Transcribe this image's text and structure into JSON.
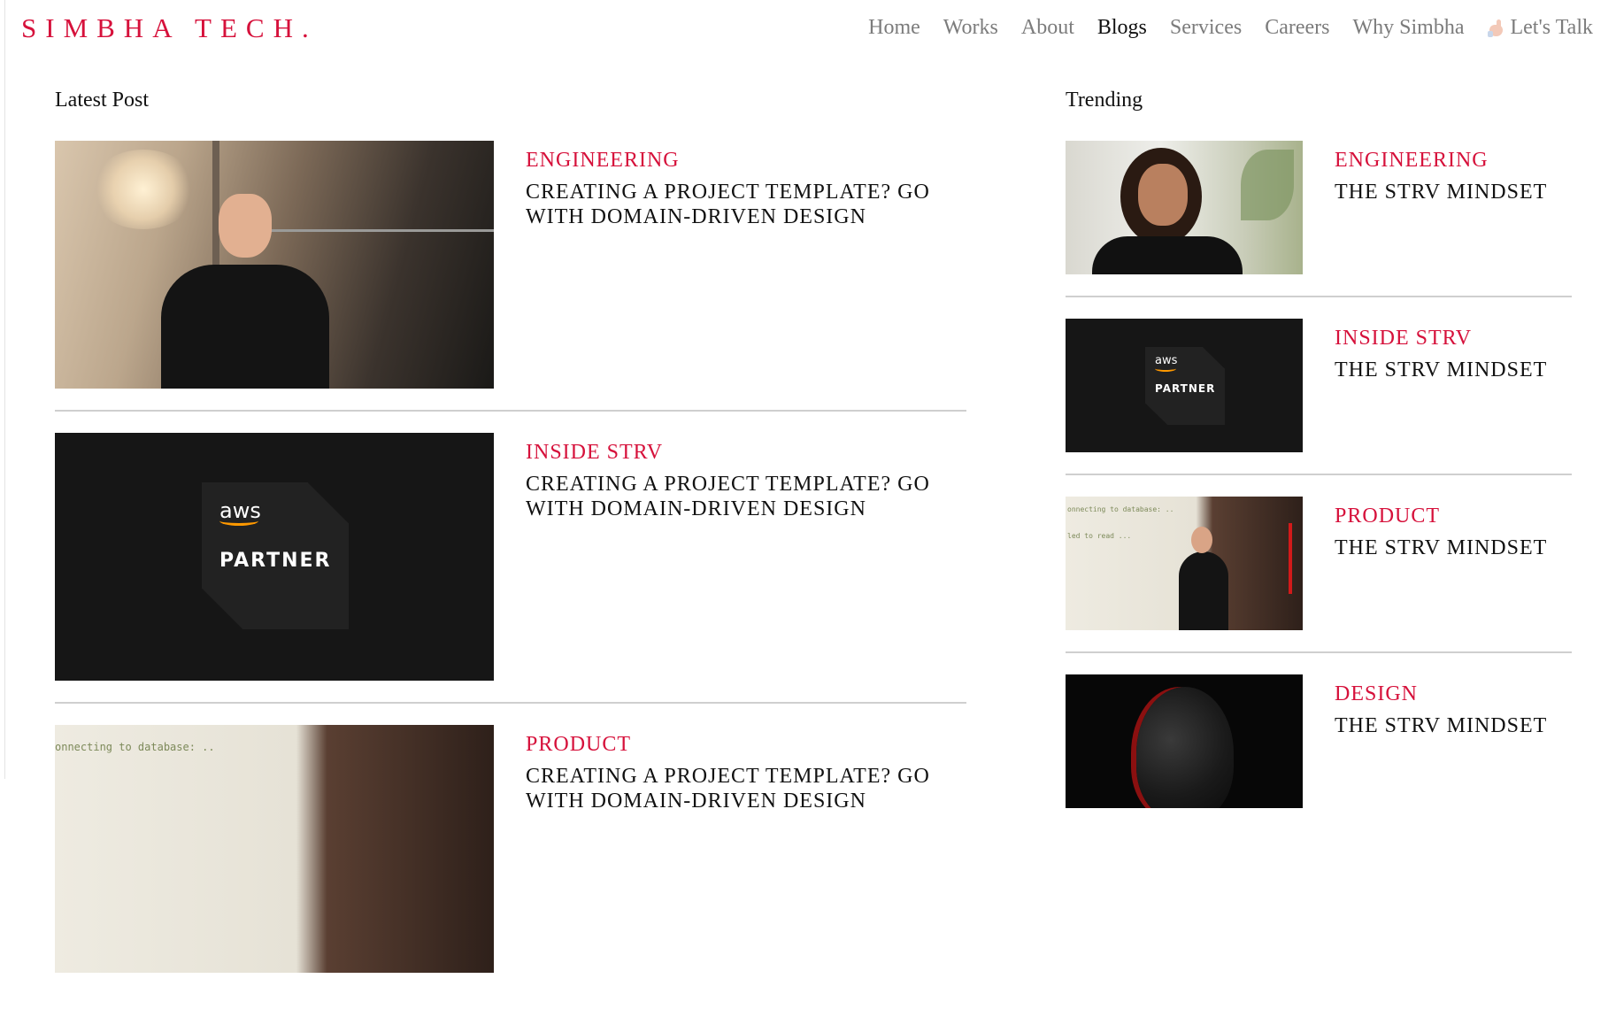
{
  "header": {
    "brand": "SIMBHA TECH.",
    "nav": [
      {
        "label": "Home",
        "active": false
      },
      {
        "label": "Works",
        "active": false
      },
      {
        "label": "About",
        "active": false
      },
      {
        "label": "Blogs",
        "active": true
      },
      {
        "label": "Services",
        "active": false
      },
      {
        "label": "Careers",
        "active": false
      },
      {
        "label": "Why Simbha",
        "active": false
      }
    ],
    "cta": {
      "label": "Let's Talk",
      "icon": "waving-hand-icon"
    }
  },
  "colors": {
    "accent": "#d6113b",
    "text": "#111111",
    "nav_inactive": "#7c7c7c",
    "divider": "#cfcfcf"
  },
  "latest": {
    "title": "Latest Post",
    "posts": [
      {
        "category": "ENGINEERING",
        "title": "CREATING A PROJECT TEMPLATE? GO WITH DOMAIN-DRIVEN DESIGN",
        "image": "man-on-terrace-photo"
      },
      {
        "category": "INSIDE STRV",
        "title": "CREATING A PROJECT TEMPLATE? GO WITH DOMAIN-DRIVEN DESIGN",
        "image": "aws-partner-badge"
      },
      {
        "category": "PRODUCT",
        "title": "CREATING A PROJECT TEMPLATE? GO WITH DOMAIN-DRIVEN DESIGN",
        "image": "speaker-presentation-photo"
      }
    ]
  },
  "trending": {
    "title": "Trending",
    "posts": [
      {
        "category": "ENGINEERING",
        "title": "THE STRV MINDSET",
        "image": "woman-portrait-photo"
      },
      {
        "category": "INSIDE STRV",
        "title": "THE STRV MINDSET",
        "image": "aws-partner-badge"
      },
      {
        "category": "PRODUCT",
        "title": "THE STRV MINDSET",
        "image": "speaker-presentation-photo"
      },
      {
        "category": "DESIGN",
        "title": "THE STRV MINDSET",
        "image": "dark-head-sculpture-photo"
      }
    ]
  },
  "aws_badge": {
    "logo": "aws",
    "label": "PARTNER"
  },
  "talk_code": {
    "line1": "onnecting to database: ..",
    "line2": "led to read ..."
  }
}
